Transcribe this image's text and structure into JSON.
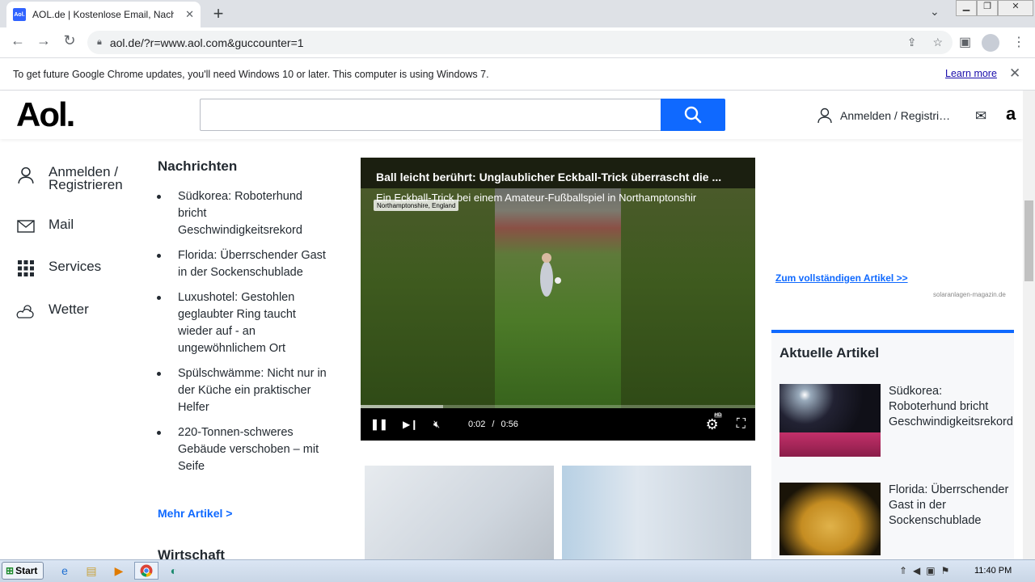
{
  "browser": {
    "tab_title": "AOL.de | Kostenlose Email, Nachrichten",
    "tab_favicon": "Aol.",
    "url": "aol.de/?r=www.aol.com&guccounter=1",
    "infobar_text": "To get future Google Chrome updates, you'll need Windows 10 or later. This computer is using Windows 7.",
    "infobar_link": "Learn more"
  },
  "header": {
    "logo": "Aol.",
    "search_placeholder": "",
    "signin": "Anmelden / Registri…"
  },
  "left_nav": [
    {
      "label": "Anmelden / Registrieren",
      "icon": "user-icon"
    },
    {
      "label": "Mail",
      "icon": "mail-icon"
    },
    {
      "label": "Services",
      "icon": "grid-icon"
    },
    {
      "label": "Wetter",
      "icon": "weather-icon"
    }
  ],
  "news": {
    "heading": "Nachrichten",
    "items": [
      "Südkorea: Roboterhund bricht Geschwindigkeitsrekord",
      "Florida: Überrschender Gast in der Sockenschublade",
      "Luxushotel: Gestohlen geglaubter Ring taucht wieder auf - an ungewöhnlichem Ort",
      "Spülschwämme: Nicht nur in der Küche ein praktischer Helfer",
      "220-Tonnen-schweres Gebäude verschoben – mit Seife"
    ],
    "more": "Mehr Artikel >",
    "next_heading": "Wirtschaft"
  },
  "video": {
    "title": "Ball leicht berührt: Unglaublicher Eckball-Trick überrascht die ...",
    "subtitle": "Ein Eckball-Trick bei einem Amateur-Fußballspiel in Northamptonshir",
    "badge": "Northamptonshire, England",
    "current_time": "0:02",
    "separator": "/",
    "duration": "0:56",
    "hd": "HD",
    "progress_fraction": 0.21
  },
  "right": {
    "link": "Zum vollständigen Artikel >>",
    "source": "solaranlagen-magazin.de",
    "heading": "Aktuelle Artikel",
    "articles": [
      "Südkorea: Roboterhund bricht Geschwindigkeitsrekord",
      "Florida: Überrschender Gast in der Sockenschublade"
    ]
  },
  "taskbar": {
    "start": "Start",
    "time": "11:40 PM"
  },
  "colors": {
    "accent": "#0f69ff",
    "text": "#232a31"
  }
}
